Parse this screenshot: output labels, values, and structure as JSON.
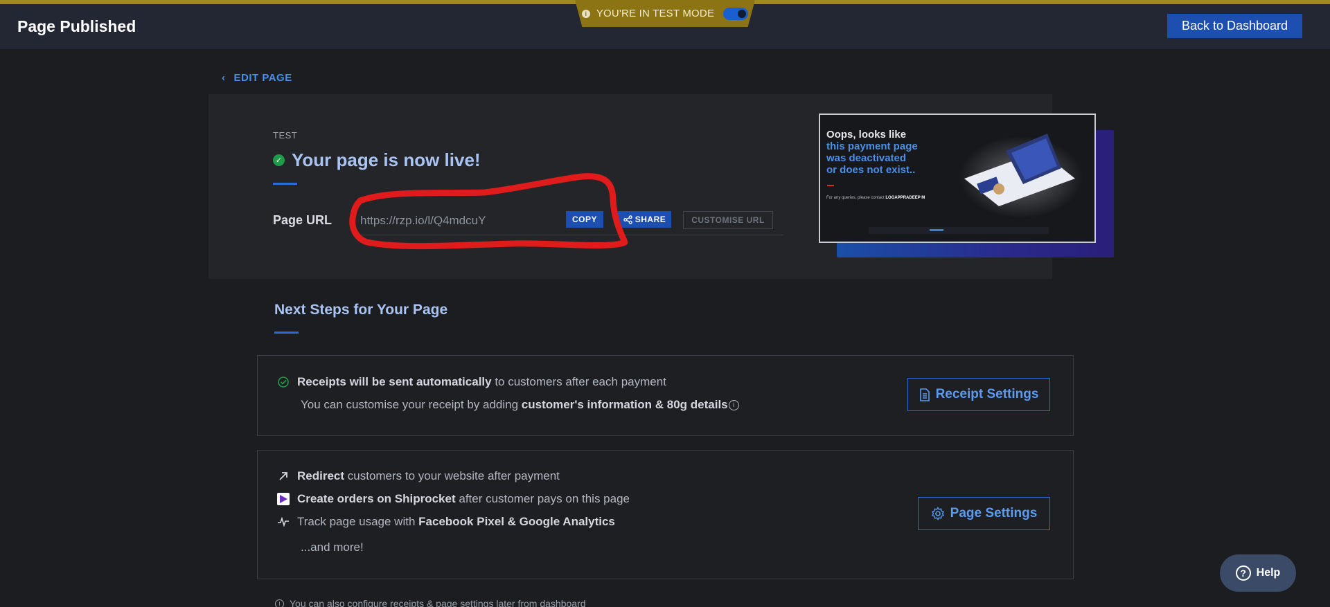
{
  "header": {
    "title": "Page Published",
    "test_mode_label": "YOU'RE IN TEST MODE",
    "test_mode_enabled": true,
    "back_button": "Back to Dashboard"
  },
  "edit_link": "EDIT PAGE",
  "hero": {
    "tag": "TEST",
    "headline": "Your page is now live!",
    "url_label": "Page URL",
    "url_value": "https://rzp.io/l/Q4mdcuY",
    "copy_label": "COPY",
    "share_label": "SHARE",
    "customise_label": "CUSTOMISE URL"
  },
  "preview": {
    "line1": "Oops, looks like",
    "line2": "this payment page",
    "line3": "was deactivated",
    "line4": "or does not exist..",
    "queries_prefix": "For any queries, please contact",
    "queries_contact": "LOGAPPRADEEP M"
  },
  "next_steps": {
    "title": "Next Steps for Your Page",
    "card1": {
      "line1_bold": "Receipts will be sent automatically",
      "line1_rest": "to customers after each payment",
      "line2_prefix": "You can customise your receipt by adding",
      "line2_bold": "customer's information & 80g details",
      "button": "Receipt Settings"
    },
    "card2": {
      "redirect_bold": "Redirect",
      "redirect_rest": "customers to your website after payment",
      "ship_bold": "Create orders on Shiprocket",
      "ship_rest": "after customer pays on this page",
      "track_prefix": "Track page usage with",
      "track_bold": "Facebook Pixel & Google Analytics",
      "more": "...and more!",
      "button": "Page Settings"
    }
  },
  "footnote": "You can also configure receipts & page settings later from dashboard",
  "help_label": "Help",
  "colors": {
    "accent": "#1c4fb0",
    "test_mode": "#8c7414",
    "success": "#1e9c4a",
    "annotation": "#e01b1b"
  }
}
